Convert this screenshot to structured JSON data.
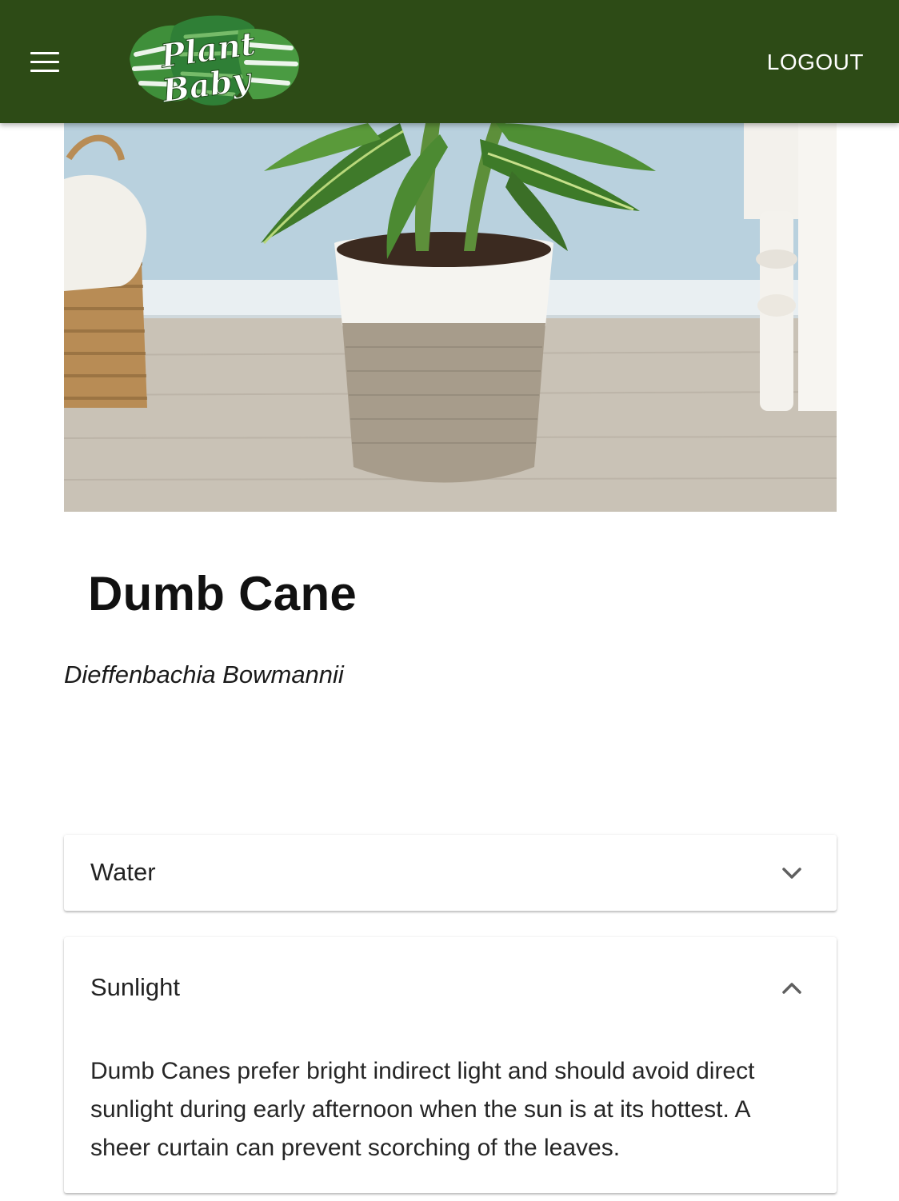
{
  "header": {
    "menu_icon": "hamburger-menu-icon",
    "logo_alt": "Plant Baby",
    "logo_line1": "Plant",
    "logo_line2": "Baby",
    "logout_label": "LOGOUT",
    "background_color": "#2d4b16"
  },
  "plant": {
    "common_name": "Dumb Cane",
    "scientific_name": "Dieffenbachia Bowmannii",
    "image_alt": "Dumb Cane plant in a white and taupe pot"
  },
  "care": {
    "sections": [
      {
        "title": "Water",
        "expanded": false,
        "icon": "chevron-down-icon"
      },
      {
        "title": "Sunlight",
        "expanded": true,
        "icon": "chevron-up-icon",
        "body": "Dumb Canes prefer bright indirect light and should avoid direct sunlight during early afternoon when the sun is at its hottest. A sheer curtain can prevent scorching of the leaves."
      }
    ]
  }
}
